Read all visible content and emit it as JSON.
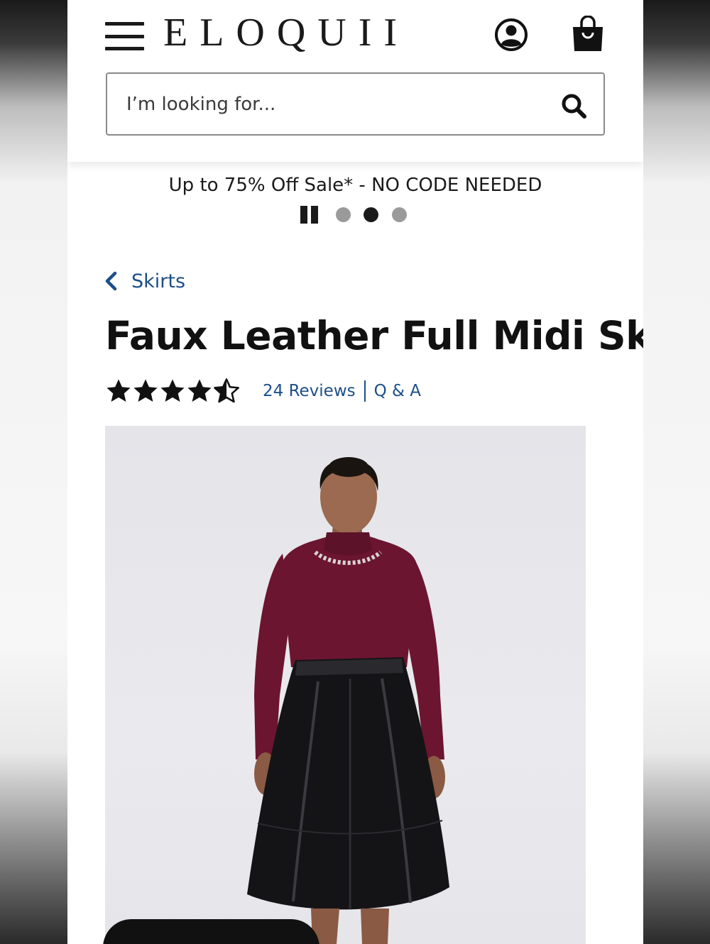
{
  "header": {
    "logo": "ELOQUII",
    "menu_icon": "hamburger-menu-icon",
    "account_icon": "account-icon",
    "bag_icon": "shopping-bag-icon"
  },
  "search": {
    "placeholder": "I’m looking for...",
    "value": "",
    "icon": "search-icon"
  },
  "promo": {
    "text": "Up to 75% Off Sale* - NO CODE NEEDED",
    "slide_count": 3,
    "active_slide": 2
  },
  "breadcrumb": {
    "label": "Skirts",
    "icon": "chevron-left-icon"
  },
  "product": {
    "title": "Faux Leather Full Midi Skirt",
    "rating": 4.5,
    "rating_max": 5,
    "reviews_label": "24 Reviews",
    "qa_label": "Q & A"
  },
  "colors": {
    "link": "#1d4e89",
    "text": "#111111",
    "sweater": "#6b1530",
    "skirt": "#141416"
  }
}
